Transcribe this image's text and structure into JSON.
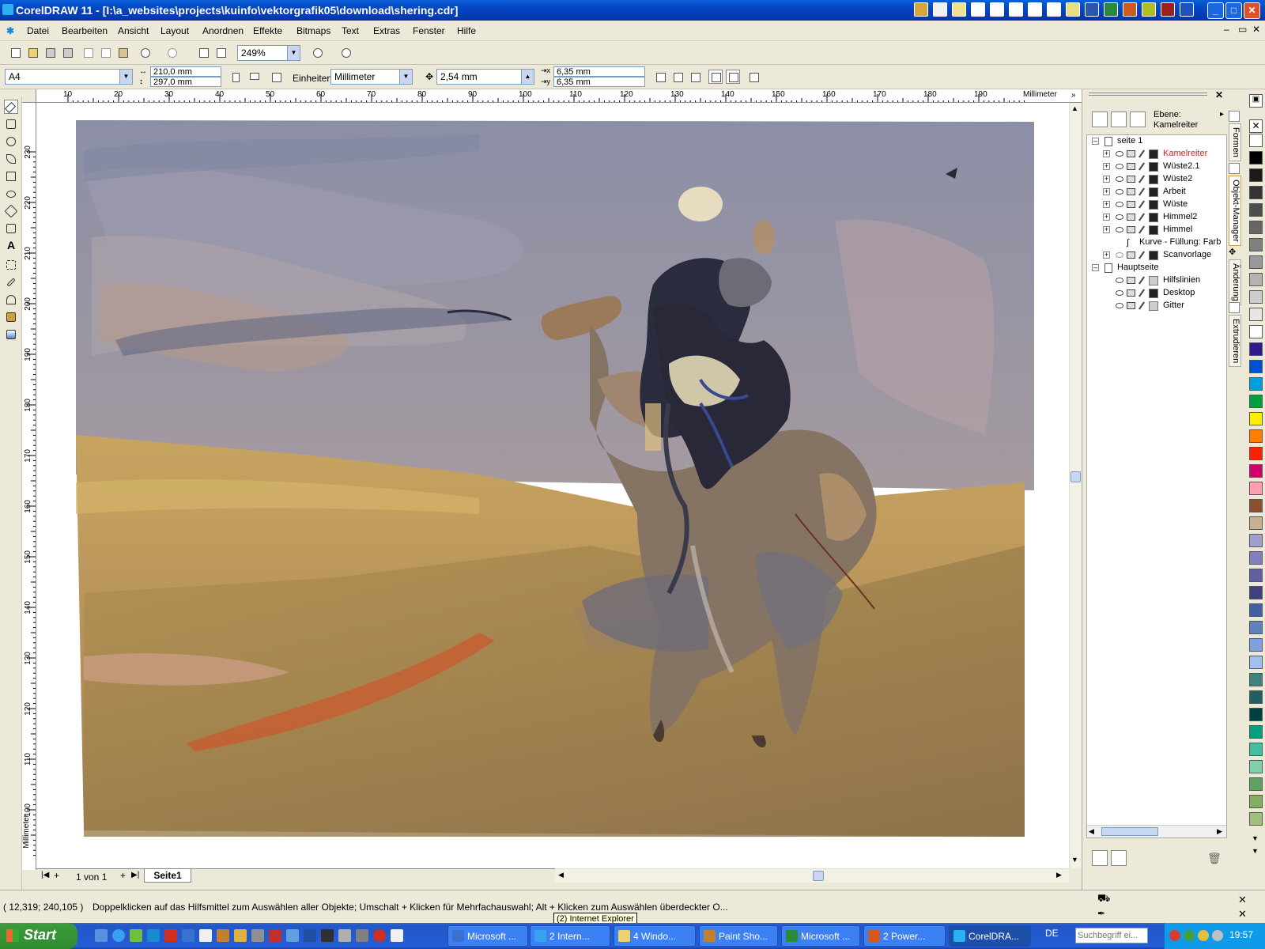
{
  "window": {
    "title": "CorelDRAW 11 - [I:\\a_websites\\projects\\kuinfo\\vektorgrafik05\\download\\shering.cdr]",
    "controls": [
      "minimize",
      "maximize",
      "close"
    ]
  },
  "menu": [
    "Datei",
    "Bearbeiten",
    "Ansicht",
    "Layout",
    "Anordnen",
    "Effekte",
    "Bitmaps",
    "Text",
    "Extras",
    "Fenster",
    "Hilfe"
  ],
  "standard_toolbar": {
    "zoom": "249%"
  },
  "property_bar": {
    "paper": "A4",
    "width": "210,0 mm",
    "height": "297,0 mm",
    "units_label": "Einheiten:",
    "units": "Millimeter",
    "nudge": "2,54 mm",
    "dup_x": "6,35 mm",
    "dup_y": "6,35 mm"
  },
  "ruler": {
    "unit": "Millimeter",
    "h_ticks": [
      "10",
      "20",
      "30",
      "40",
      "50",
      "60",
      "70",
      "80",
      "90",
      "100",
      "110",
      "120",
      "130",
      "140",
      "150",
      "160",
      "170",
      "180",
      "190"
    ],
    "v_ticks": [
      "230",
      "220",
      "210",
      "200",
      "190",
      "180",
      "170",
      "160",
      "150",
      "140",
      "130",
      "120",
      "110",
      "100"
    ]
  },
  "page_nav": {
    "count": "1 von 1",
    "tab": "Seite1"
  },
  "object_manager": {
    "layer_label": "Ebene:",
    "layer_name": "Kamelreiter",
    "page1": "seite 1",
    "layers": [
      {
        "name": "Kamelreiter",
        "color": "#222222",
        "active": true
      },
      {
        "name": "Wüste2.1",
        "color": "#222222",
        "active": false
      },
      {
        "name": "Wüste2",
        "color": "#222222",
        "active": false
      },
      {
        "name": "Arbeit",
        "color": "#222222",
        "active": false
      },
      {
        "name": "Wüste",
        "color": "#222222",
        "active": false
      },
      {
        "name": "Himmel2",
        "color": "#222222",
        "active": false
      },
      {
        "name": "Himmel",
        "color": "#222222",
        "active": false
      }
    ],
    "curve_item": "Kurve - Füllung: Farb",
    "scan_layer": "Scanvorlage",
    "master": "Hauptseite",
    "master_layers": [
      {
        "name": "Hilfslinien",
        "color": "#cccccc"
      },
      {
        "name": "Desktop",
        "color": "#222222"
      },
      {
        "name": "Gitter",
        "color": "#cccccc"
      }
    ]
  },
  "docker_tabs": [
    "Formen",
    "Objekt-Manager",
    "Änderung",
    "Extrudieren"
  ],
  "palette": [
    "#ffffff",
    "#000000",
    "#1a1a1a",
    "#333333",
    "#4d4d4d",
    "#666666",
    "#808080",
    "#999999",
    "#b3b3b3",
    "#cccccc",
    "#e6e6e6",
    "#ffffff",
    "#2e1a8c",
    "#0050d0",
    "#00a0e0",
    "#00a040",
    "#ffee00",
    "#ff8000",
    "#ff2000",
    "#d0006f",
    "#ff9fb0",
    "#8a5030",
    "#c8b090",
    "#a0a0d0",
    "#8080c0",
    "#6060a0",
    "#404080",
    "#4060a0",
    "#6080c0",
    "#80a0e0",
    "#a0c0f0",
    "#408080",
    "#206060",
    "#004040",
    "#00a080",
    "#40c0a0",
    "#80d0b0",
    "#60a060",
    "#80b060",
    "#a0c080"
  ],
  "status": {
    "coords": "( 12,319; 240,105 )",
    "hint": "Doppelklicken auf das Hilfsmittel zum Auswählen aller Objekte; Umschalt + Klicken für Mehrfachauswahl; Alt + Klicken zum Auswählen überdeckter O...",
    "tooltip": "(2) Internet Explorer"
  },
  "taskbar": {
    "start": "Start",
    "tasks": [
      "Microsoft ...",
      "2 Intern...",
      "4 Windo...",
      "Paint Sho...",
      "Microsoft ...",
      "2 Power...",
      "CorelDRA..."
    ],
    "search_placeholder": "Suchbegriff ei...",
    "lang": "DE",
    "clock": "19:57"
  }
}
